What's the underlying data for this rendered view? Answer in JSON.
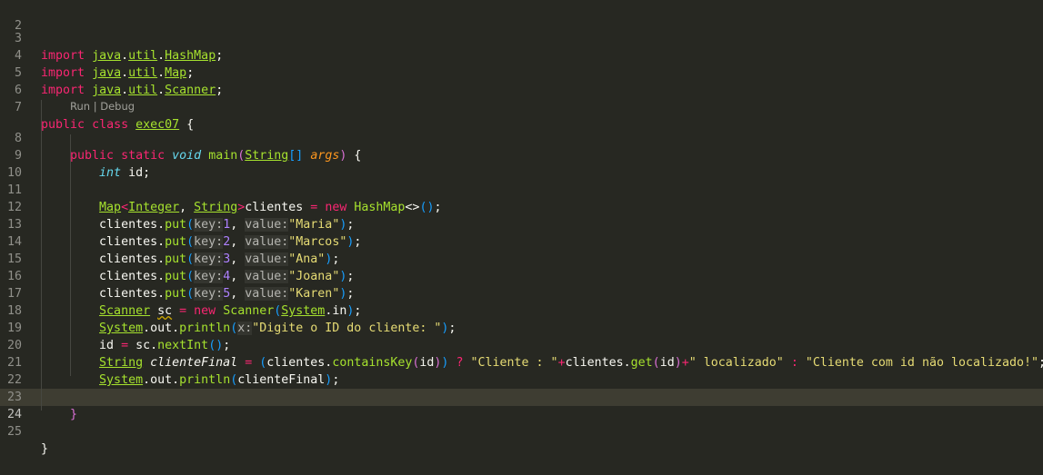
{
  "lines": [
    {
      "n": "2"
    },
    {
      "n": "3"
    },
    {
      "n": "4"
    },
    {
      "n": "5"
    },
    {
      "n": "6"
    },
    {
      "n": "7"
    },
    {
      "n": "8"
    },
    {
      "n": "9"
    },
    {
      "n": "10"
    },
    {
      "n": "11"
    },
    {
      "n": "12"
    },
    {
      "n": "13"
    },
    {
      "n": "14"
    },
    {
      "n": "15"
    },
    {
      "n": "16"
    },
    {
      "n": "17"
    },
    {
      "n": "18"
    },
    {
      "n": "19"
    },
    {
      "n": "20"
    },
    {
      "n": "21"
    },
    {
      "n": "22"
    },
    {
      "n": "23"
    },
    {
      "n": "24"
    },
    {
      "n": "25"
    }
  ],
  "codelens": {
    "run": "Run",
    "sep": " | ",
    "debug": "Debug"
  },
  "tok": {
    "import": "import",
    "java": "java",
    "util": "util",
    "dot": ".",
    "semi": ";",
    "HashMap": "HashMap",
    "Map": "Map",
    "Scanner": "Scanner",
    "public": "public",
    "class": "class",
    "exec07": "exec07",
    "lbrace": "{",
    "rbrace": "}",
    "static": "static",
    "void": "void",
    "main": "main",
    "lparen": "(",
    "rparen": ")",
    "String": "String",
    "brackets": "[]",
    "args": "args",
    "int": "int",
    "id": "id",
    "lt": "<",
    "gt": ">",
    "Integer": "Integer",
    "comma": ",",
    "clientes": "clientes",
    "eq": "=",
    "new": "new",
    "diamond": "<>",
    "parens": "()",
    "put": "put",
    "hint_key": "key:",
    "hint_value": "value:",
    "hint_x": "x:",
    "sc": "sc",
    "System": "System",
    "in": "in",
    "out": "out",
    "println": "println",
    "nextInt": "nextInt",
    "clienteFinal": "clienteFinal",
    "containsKey": "containsKey",
    "q": "?",
    "plus": "+",
    "get": "get",
    "colon": ":"
  },
  "puts": [
    {
      "key": "1",
      "value": "\"Maria\""
    },
    {
      "key": "2",
      "value": "\"Marcos\""
    },
    {
      "key": "3",
      "value": "\"Ana\""
    },
    {
      "key": "4",
      "value": "\"Joana\""
    },
    {
      "key": "5",
      "value": "\"Karen\""
    }
  ],
  "strings": {
    "prompt": "\"Digite o ID do cliente: \"",
    "cliente": "\"Cliente : \"",
    "localizado": "\" localizado\"",
    "nao_localizado": "\"Cliente com id não localizado!\""
  },
  "colors": {
    "background": "#272822",
    "keyword": "#f92672",
    "type": "#66d9ef",
    "class": "#a6e22e",
    "string": "#e6db74",
    "number": "#ae81ff",
    "parameter": "#fd971f",
    "current_line": "#3e3d32"
  }
}
